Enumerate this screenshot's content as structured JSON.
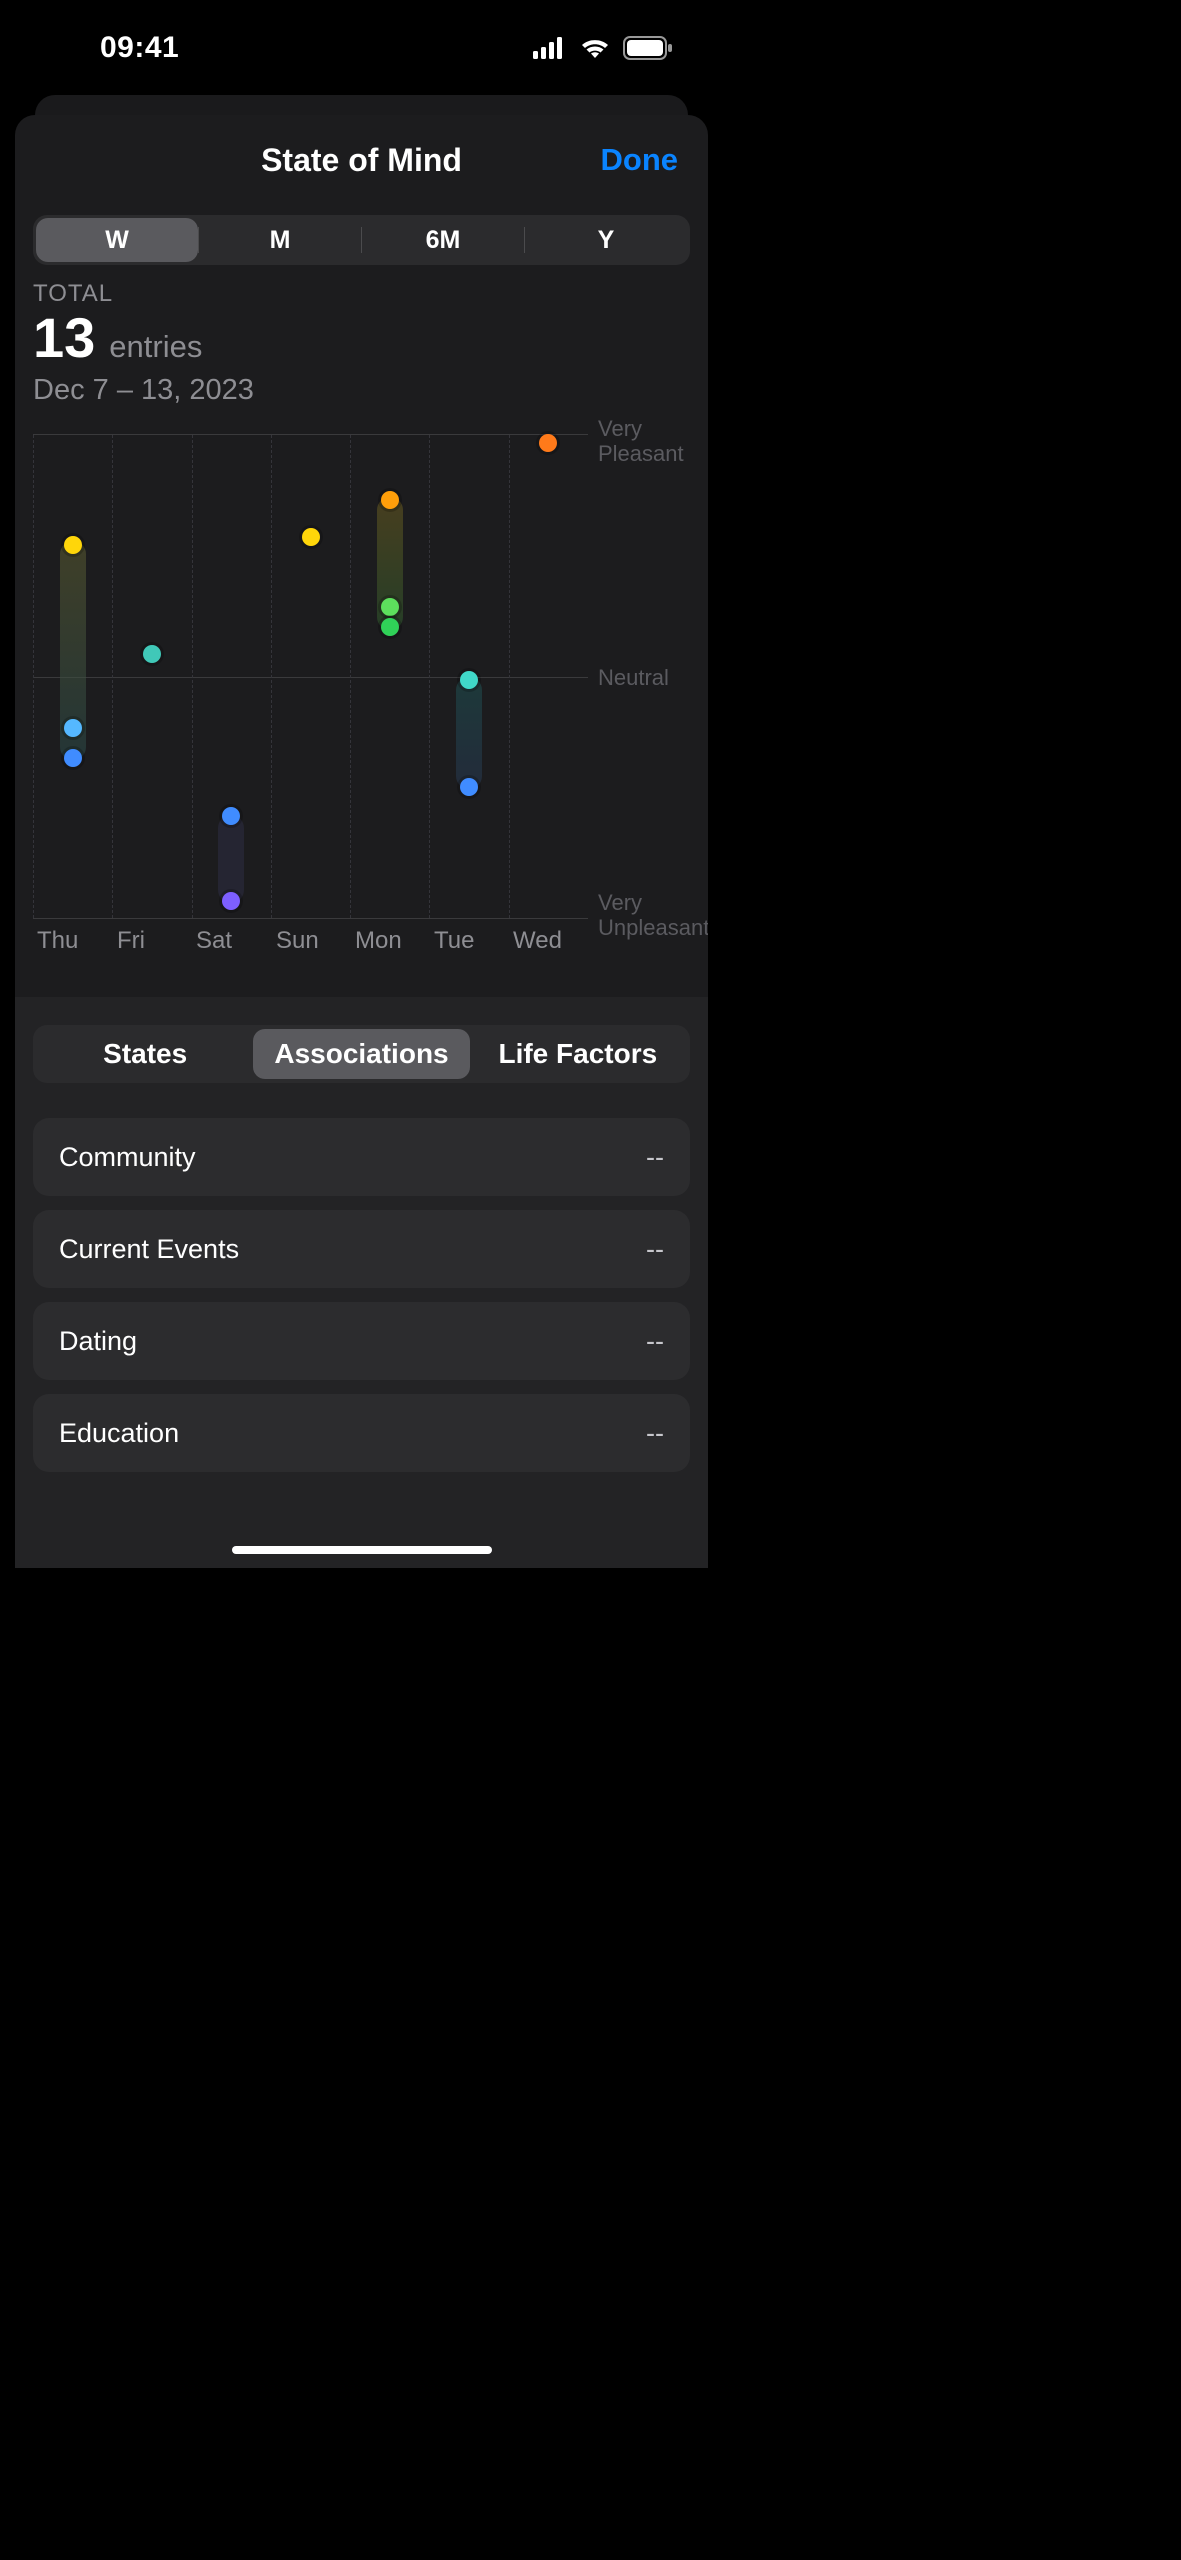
{
  "status": {
    "time": "09:41"
  },
  "nav": {
    "title": "State of Mind",
    "done": "Done"
  },
  "range": {
    "items": [
      "W",
      "M",
      "6M",
      "Y"
    ],
    "selected": 0
  },
  "summary": {
    "total_label": "TOTAL",
    "count": "13",
    "unit": "entries",
    "dates": "Dec 7 – 13, 2023"
  },
  "chart": {
    "days": [
      "Thu",
      "Fri",
      "Sat",
      "Sun",
      "Mon",
      "Tue",
      "Wed"
    ],
    "ylabels": {
      "top": "Very\nPleasant",
      "mid": "Neutral",
      "bot": "Very\nUnpleasant"
    }
  },
  "chart_data": {
    "type": "scatter",
    "xlabel": "",
    "ylabel": "",
    "y_scale": {
      "min": -1,
      "max": 1,
      "labels": {
        "-1": "Very Unpleasant",
        "0": "Neutral",
        "1": "Very Pleasant"
      }
    },
    "categories": [
      "Thu",
      "Fri",
      "Sat",
      "Sun",
      "Mon",
      "Tue",
      "Wed"
    ],
    "series": [
      {
        "name": "entries",
        "points": [
          {
            "x": "Thu",
            "y": 0.55
          },
          {
            "x": "Thu",
            "y": -0.2
          },
          {
            "x": "Thu",
            "y": -0.33
          },
          {
            "x": "Fri",
            "y": 0.1
          },
          {
            "x": "Sat",
            "y": -0.57
          },
          {
            "x": "Sat",
            "y": -0.92
          },
          {
            "x": "Sun",
            "y": 0.58
          },
          {
            "x": "Mon",
            "y": 0.73
          },
          {
            "x": "Mon",
            "y": 0.29
          },
          {
            "x": "Mon",
            "y": 0.21
          },
          {
            "x": "Tue",
            "y": -0.01
          },
          {
            "x": "Tue",
            "y": -0.45
          },
          {
            "x": "Wed",
            "y": 0.98
          }
        ]
      }
    ]
  },
  "bottom_tabs": {
    "items": [
      "States",
      "Associations",
      "Life Factors"
    ],
    "selected": 1
  },
  "associations": [
    {
      "name": "Community",
      "value": "--"
    },
    {
      "name": "Current Events",
      "value": "--"
    },
    {
      "name": "Dating",
      "value": "--"
    },
    {
      "name": "Education",
      "value": "--"
    }
  ],
  "colors": {
    "accent": "#0a84ff",
    "orange": "#ff9f0a",
    "yellow": "#ffd60a",
    "green": "#30d158",
    "teal": "#40c8b8",
    "blue": "#408cff",
    "purple": "#7d5fff"
  }
}
